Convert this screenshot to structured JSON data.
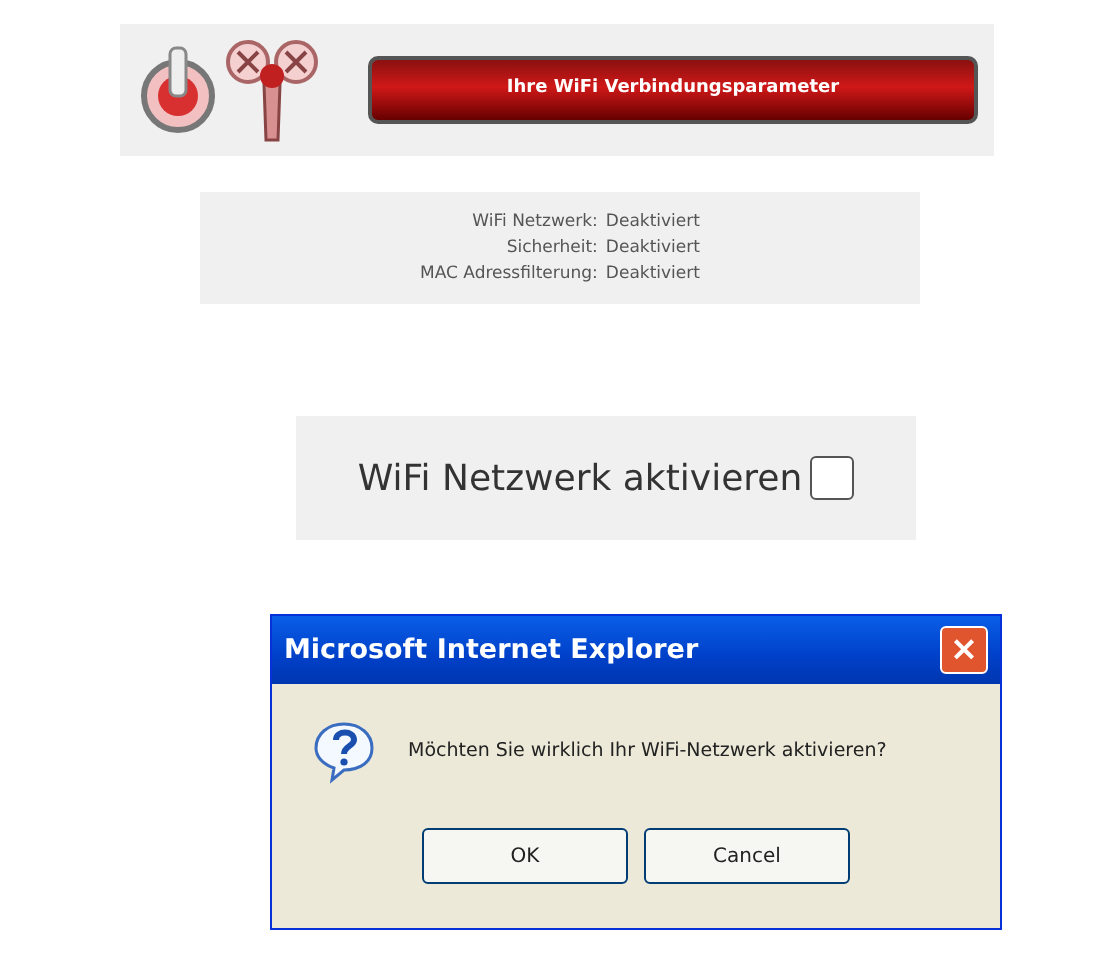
{
  "header": {
    "title": "Ihre WiFi Verbindungsparameter"
  },
  "status": [
    {
      "label": "WiFi Netzwerk:",
      "value": "Deaktiviert"
    },
    {
      "label": "Sicherheit:",
      "value": "Deaktiviert"
    },
    {
      "label": "MAC Adressfilterung:",
      "value": "Deaktiviert"
    }
  ],
  "activate": {
    "label": "WiFi Netzwerk aktivieren",
    "checked": false
  },
  "dialog": {
    "title": "Microsoft Internet Explorer",
    "close": "×",
    "message": "Möchten Sie wirklich Ihr WiFi-Netzwerk aktivieren?",
    "buttons": [
      "OK",
      "Cancel"
    ]
  }
}
